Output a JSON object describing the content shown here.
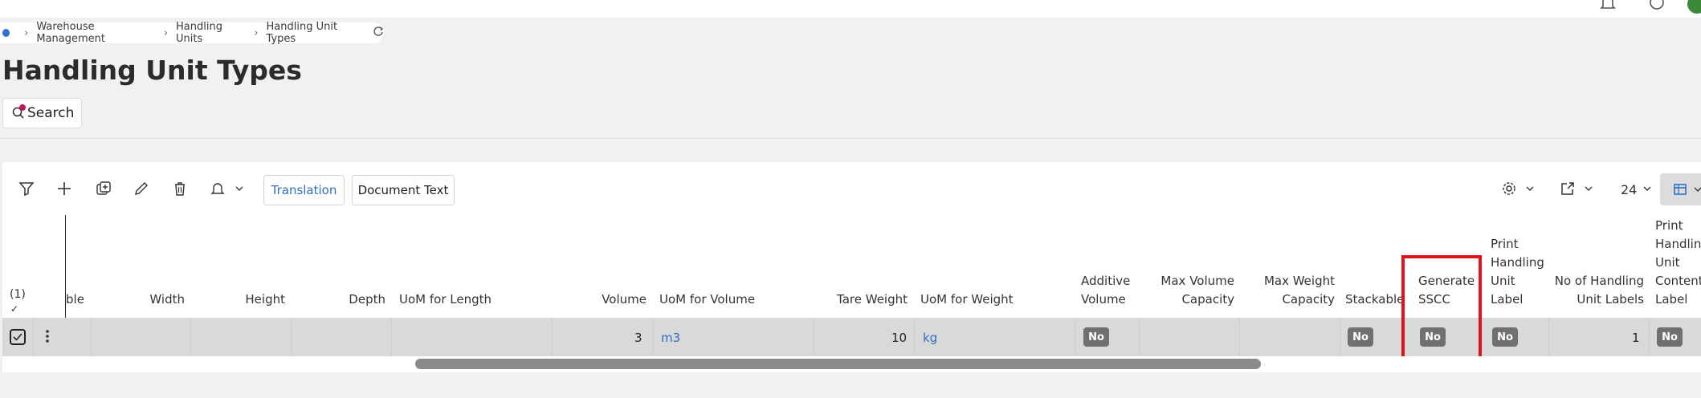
{
  "breadcrumb": {
    "items": [
      "Warehouse Management",
      "Handling Units",
      "Handling Unit Types"
    ],
    "separator": "›",
    "refresh_icon": "refresh-icon"
  },
  "page": {
    "title": "Handling Unit Types"
  },
  "search": {
    "label": "Search"
  },
  "toolbar": {
    "translation_label": "Translation",
    "document_text_label": "Document Text",
    "rows_per_page": "24"
  },
  "table": {
    "selection_count": "(1)",
    "columns": [
      "ble",
      "Width",
      "Height",
      "Depth",
      "UoM for Length",
      "Volume",
      "UoM for Volume",
      "Tare Weight",
      "UoM for Weight",
      "Additive Volume",
      "Max Volume Capacity",
      "Max Weight Capacity",
      "Stackable",
      "Generate SSCC",
      "Print Handling Unit Label",
      "No of Handling Unit Labels",
      "Print Handling Unit Content Label"
    ],
    "row": {
      "volume": "3",
      "uom_volume": "m3",
      "tare_weight": "10",
      "uom_weight": "kg",
      "additive_volume": "No",
      "stackable": "No",
      "generate_sscc": "No",
      "print_hu_label": "No",
      "no_of_hu_labels": "1",
      "print_hu_content_label": "No"
    }
  },
  "colors": {
    "accent": "#2f73d3",
    "link": "#2f6ec2",
    "highlight": "#e0131b",
    "badge": "#707070"
  }
}
